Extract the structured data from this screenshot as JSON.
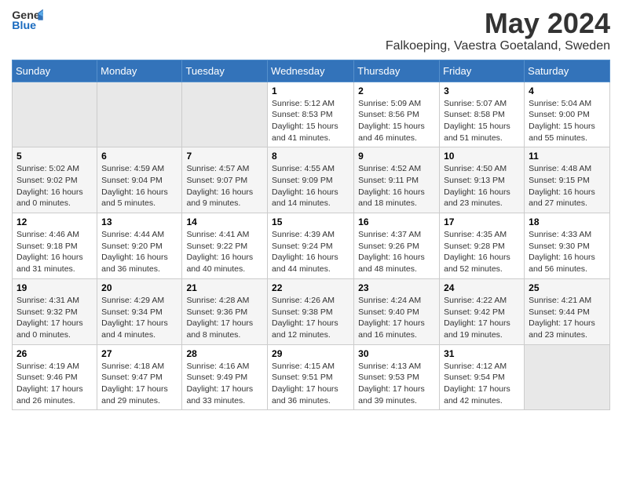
{
  "header": {
    "logo_general": "General",
    "logo_blue": "Blue",
    "title": "May 2024",
    "subtitle": "Falkoeping, Vaestra Goetaland, Sweden"
  },
  "days_of_week": [
    "Sunday",
    "Monday",
    "Tuesday",
    "Wednesday",
    "Thursday",
    "Friday",
    "Saturday"
  ],
  "weeks": [
    [
      {
        "day": "",
        "info": ""
      },
      {
        "day": "",
        "info": ""
      },
      {
        "day": "",
        "info": ""
      },
      {
        "day": "1",
        "info": "Sunrise: 5:12 AM\nSunset: 8:53 PM\nDaylight: 15 hours and 41 minutes."
      },
      {
        "day": "2",
        "info": "Sunrise: 5:09 AM\nSunset: 8:56 PM\nDaylight: 15 hours and 46 minutes."
      },
      {
        "day": "3",
        "info": "Sunrise: 5:07 AM\nSunset: 8:58 PM\nDaylight: 15 hours and 51 minutes."
      },
      {
        "day": "4",
        "info": "Sunrise: 5:04 AM\nSunset: 9:00 PM\nDaylight: 15 hours and 55 minutes."
      }
    ],
    [
      {
        "day": "5",
        "info": "Sunrise: 5:02 AM\nSunset: 9:02 PM\nDaylight: 16 hours and 0 minutes."
      },
      {
        "day": "6",
        "info": "Sunrise: 4:59 AM\nSunset: 9:04 PM\nDaylight: 16 hours and 5 minutes."
      },
      {
        "day": "7",
        "info": "Sunrise: 4:57 AM\nSunset: 9:07 PM\nDaylight: 16 hours and 9 minutes."
      },
      {
        "day": "8",
        "info": "Sunrise: 4:55 AM\nSunset: 9:09 PM\nDaylight: 16 hours and 14 minutes."
      },
      {
        "day": "9",
        "info": "Sunrise: 4:52 AM\nSunset: 9:11 PM\nDaylight: 16 hours and 18 minutes."
      },
      {
        "day": "10",
        "info": "Sunrise: 4:50 AM\nSunset: 9:13 PM\nDaylight: 16 hours and 23 minutes."
      },
      {
        "day": "11",
        "info": "Sunrise: 4:48 AM\nSunset: 9:15 PM\nDaylight: 16 hours and 27 minutes."
      }
    ],
    [
      {
        "day": "12",
        "info": "Sunrise: 4:46 AM\nSunset: 9:18 PM\nDaylight: 16 hours and 31 minutes."
      },
      {
        "day": "13",
        "info": "Sunrise: 4:44 AM\nSunset: 9:20 PM\nDaylight: 16 hours and 36 minutes."
      },
      {
        "day": "14",
        "info": "Sunrise: 4:41 AM\nSunset: 9:22 PM\nDaylight: 16 hours and 40 minutes."
      },
      {
        "day": "15",
        "info": "Sunrise: 4:39 AM\nSunset: 9:24 PM\nDaylight: 16 hours and 44 minutes."
      },
      {
        "day": "16",
        "info": "Sunrise: 4:37 AM\nSunset: 9:26 PM\nDaylight: 16 hours and 48 minutes."
      },
      {
        "day": "17",
        "info": "Sunrise: 4:35 AM\nSunset: 9:28 PM\nDaylight: 16 hours and 52 minutes."
      },
      {
        "day": "18",
        "info": "Sunrise: 4:33 AM\nSunset: 9:30 PM\nDaylight: 16 hours and 56 minutes."
      }
    ],
    [
      {
        "day": "19",
        "info": "Sunrise: 4:31 AM\nSunset: 9:32 PM\nDaylight: 17 hours and 0 minutes."
      },
      {
        "day": "20",
        "info": "Sunrise: 4:29 AM\nSunset: 9:34 PM\nDaylight: 17 hours and 4 minutes."
      },
      {
        "day": "21",
        "info": "Sunrise: 4:28 AM\nSunset: 9:36 PM\nDaylight: 17 hours and 8 minutes."
      },
      {
        "day": "22",
        "info": "Sunrise: 4:26 AM\nSunset: 9:38 PM\nDaylight: 17 hours and 12 minutes."
      },
      {
        "day": "23",
        "info": "Sunrise: 4:24 AM\nSunset: 9:40 PM\nDaylight: 17 hours and 16 minutes."
      },
      {
        "day": "24",
        "info": "Sunrise: 4:22 AM\nSunset: 9:42 PM\nDaylight: 17 hours and 19 minutes."
      },
      {
        "day": "25",
        "info": "Sunrise: 4:21 AM\nSunset: 9:44 PM\nDaylight: 17 hours and 23 minutes."
      }
    ],
    [
      {
        "day": "26",
        "info": "Sunrise: 4:19 AM\nSunset: 9:46 PM\nDaylight: 17 hours and 26 minutes."
      },
      {
        "day": "27",
        "info": "Sunrise: 4:18 AM\nSunset: 9:47 PM\nDaylight: 17 hours and 29 minutes."
      },
      {
        "day": "28",
        "info": "Sunrise: 4:16 AM\nSunset: 9:49 PM\nDaylight: 17 hours and 33 minutes."
      },
      {
        "day": "29",
        "info": "Sunrise: 4:15 AM\nSunset: 9:51 PM\nDaylight: 17 hours and 36 minutes."
      },
      {
        "day": "30",
        "info": "Sunrise: 4:13 AM\nSunset: 9:53 PM\nDaylight: 17 hours and 39 minutes."
      },
      {
        "day": "31",
        "info": "Sunrise: 4:12 AM\nSunset: 9:54 PM\nDaylight: 17 hours and 42 minutes."
      },
      {
        "day": "",
        "info": ""
      }
    ]
  ]
}
